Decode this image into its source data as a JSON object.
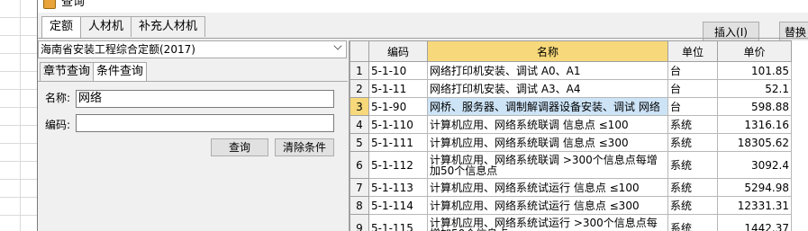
{
  "window": {
    "title": "查询"
  },
  "top_tabs": [
    "定额",
    "人材机",
    "补充人材机"
  ],
  "buttons": {
    "insert": "插入(I)",
    "replace": "替换"
  },
  "left": {
    "quota_library": "海南省安装工程综合定额(2017)",
    "subtabs": [
      "章节查询",
      "条件查询"
    ],
    "name_label": "名称:",
    "name_value": "网络",
    "code_label": "编码:",
    "code_value": "",
    "query_button": "查询",
    "clear_button": "清除条件"
  },
  "table": {
    "headers": [
      "",
      "编码",
      "名称",
      "单位",
      "单价"
    ],
    "rows": [
      {
        "no": "1",
        "code": "5-1-10",
        "name": "网络打印机安装、调试 A0、A1",
        "unit": "台",
        "price": "101.85"
      },
      {
        "no": "2",
        "code": "5-1-11",
        "name": "网络打印机安装、调试 A3、A4",
        "unit": "台",
        "price": "52.1"
      },
      {
        "no": "3",
        "code": "5-1-90",
        "name": "网桥、服务器、调制解调器设备安装、调试 网络",
        "unit": "台",
        "price": "598.88"
      },
      {
        "no": "4",
        "code": "5-1-110",
        "name": "计算机应用、网络系统联调 信息点 ≤100",
        "unit": "系统",
        "price": "1316.16"
      },
      {
        "no": "5",
        "code": "5-1-111",
        "name": "计算机应用、网络系统联调 信息点 ≤300",
        "unit": "系统",
        "price": "18305.62"
      },
      {
        "no": "6",
        "code": "5-1-112",
        "name": "计算机应用、网络系统联调 >300个信息点每增加50个信息点",
        "unit": "系统",
        "price": "3092.4"
      },
      {
        "no": "7",
        "code": "5-1-113",
        "name": "计算机应用、网络系统试运行 信息点 ≤100",
        "unit": "系统",
        "price": "5294.98"
      },
      {
        "no": "8",
        "code": "5-1-114",
        "name": "计算机应用、网络系统试运行 信息点 ≤300",
        "unit": "系统",
        "price": "12331.31"
      },
      {
        "no": "9",
        "code": "5-1-115",
        "name": "计算机应用、网络系统试运行 >300个信息点每增加50个信息点",
        "unit": "系统",
        "price": "1442.37"
      }
    ]
  }
}
